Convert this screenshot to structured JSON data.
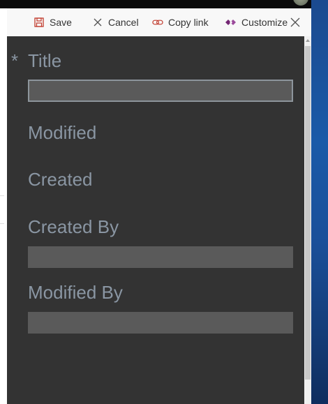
{
  "toolbar": {
    "save_label": "Save",
    "cancel_label": "Cancel",
    "copy_link_label": "Copy link",
    "customize_label": "Customize"
  },
  "form": {
    "required_marker": "*",
    "fields": [
      {
        "label": "Title",
        "required": true,
        "has_input": true
      },
      {
        "label": "Modified",
        "required": false,
        "has_input": false
      },
      {
        "label": "Created",
        "required": false,
        "has_input": false
      },
      {
        "label": "Created By",
        "required": false,
        "has_input": true
      },
      {
        "label": "Modified By",
        "required": false,
        "has_input": true
      }
    ]
  },
  "icons": {
    "save": "save-icon",
    "cancel": "cancel-icon",
    "copy_link": "link-icon",
    "customize": "power-apps-icon",
    "close": "close-icon"
  },
  "colors": {
    "form_background": "#333333",
    "label_text": "#8a96a3",
    "input_fill": "#5a5a5a",
    "save_icon": "#c0392b",
    "link_icon": "#c0392b",
    "customize_icon": "#742774"
  }
}
